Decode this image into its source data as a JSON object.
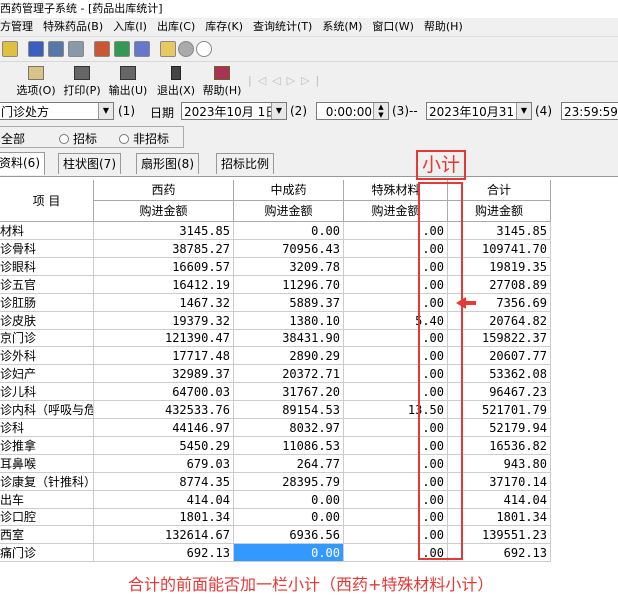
{
  "window": {
    "title": "西药管理子系统 - [药品出库统计]"
  },
  "menu": [
    "方管理",
    "特殊药品(B)",
    "入库(I)",
    "出库(C)",
    "库存(K)",
    "查询统计(T)",
    "系统(M)",
    "窗口(W)",
    "帮助(H)"
  ],
  "toolbar2": {
    "options_label": "选项(O)",
    "print_label": "打印(P)",
    "export_label": "输出(U)",
    "exit_label": "退出(X)",
    "help_label": "帮助(H)"
  },
  "filter": {
    "dept_value": "门诊处方",
    "dept_hotkey": "(1)",
    "date_label": "日期",
    "date_from": "2023年10月 1日",
    "hotkey2": "(2)",
    "time_from": "0:00:00",
    "hotkey3": "(3)--",
    "date_to": "2023年10月31日",
    "hotkey4": "(4)",
    "time_to": "23:59:59"
  },
  "radios": [
    "全部",
    "招标",
    "非招标"
  ],
  "tabs": [
    "资料(6)",
    "柱状图(7)",
    "扇形图(8)",
    "招标比例"
  ],
  "table": {
    "header_item": "项  目",
    "groups": [
      "西药",
      "中成药",
      "特殊材料",
      "合计"
    ],
    "subheader": [
      "购进金额",
      "购进金额",
      "购进金额",
      "购进金额"
    ],
    "rows": [
      {
        "name": "材料",
        "c1": "3145.85",
        "c2": "0.00",
        "c3": ".00",
        "c4": "3145.85"
      },
      {
        "name": "诊骨科",
        "c1": "38785.27",
        "c2": "70956.43",
        "c3": ".00",
        "c4": "109741.70"
      },
      {
        "name": "诊眼科",
        "c1": "16609.57",
        "c2": "3209.78",
        "c3": ".00",
        "c4": "19819.35"
      },
      {
        "name": "诊五官",
        "c1": "16412.19",
        "c2": "11296.70",
        "c3": ".00",
        "c4": "27708.89"
      },
      {
        "name": "诊肛肠",
        "c1": "1467.32",
        "c2": "5889.37",
        "c3": ".00",
        "c4": "7356.69"
      },
      {
        "name": "诊皮肤",
        "c1": "19379.32",
        "c2": "1380.10",
        "c3": "5.40",
        "c4": "20764.82"
      },
      {
        "name": "京门诊",
        "c1": "121390.47",
        "c2": "38431.90",
        "c3": ".00",
        "c4": "159822.37"
      },
      {
        "name": "诊外科",
        "c1": "17717.48",
        "c2": "2890.29",
        "c3": ".00",
        "c4": "20607.77"
      },
      {
        "name": "诊妇产",
        "c1": "32989.37",
        "c2": "20372.71",
        "c3": ".00",
        "c4": "53362.08"
      },
      {
        "name": "诊儿科",
        "c1": "64700.03",
        "c2": "31767.20",
        "c3": ".00",
        "c4": "96467.23"
      },
      {
        "name": "诊内科（呼吸与危",
        "c1": "432533.76",
        "c2": "89154.53",
        "c3": "13.50",
        "c4": "521701.79"
      },
      {
        "name": "诊科",
        "c1": "44146.97",
        "c2": "8032.97",
        "c3": ".00",
        "c4": "52179.94"
      },
      {
        "name": "诊推拿",
        "c1": "5450.29",
        "c2": "11086.53",
        "c3": ".00",
        "c4": "16536.82"
      },
      {
        "name": "耳鼻喉",
        "c1": "679.03",
        "c2": "264.77",
        "c3": ".00",
        "c4": "943.80"
      },
      {
        "name": "诊康复（针推科）",
        "c1": "8774.35",
        "c2": "28395.79",
        "c3": ".00",
        "c4": "37170.14"
      },
      {
        "name": "出车",
        "c1": "414.04",
        "c2": "0.00",
        "c3": ".00",
        "c4": "414.04"
      },
      {
        "name": "诊口腔",
        "c1": "1801.34",
        "c2": "0.00",
        "c3": ".00",
        "c4": "1801.34"
      },
      {
        "name": "西室",
        "c1": "132614.67",
        "c2": "6936.56",
        "c3": ".00",
        "c4": "139551.23"
      },
      {
        "name": "痛门诊",
        "c1": "692.13",
        "c2": "0.00",
        "c3": ".00",
        "c4": "692.13"
      }
    ]
  },
  "annotation": {
    "title": "小计",
    "note": "合计的前面能否加一栏小计（西药+特殊材料小计）",
    "color": "#e53935"
  }
}
